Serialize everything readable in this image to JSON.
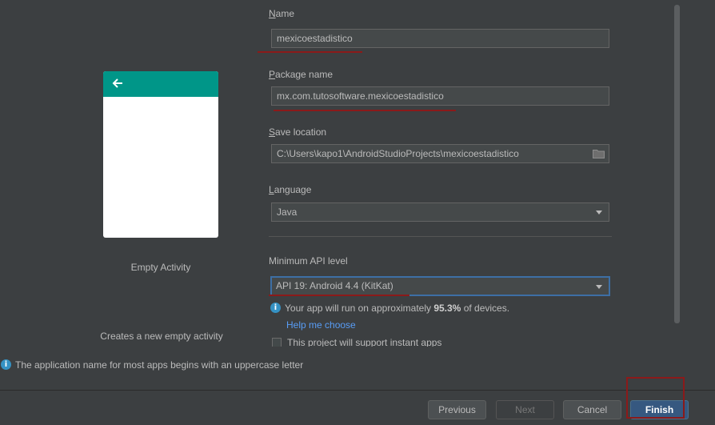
{
  "preview": {
    "template_name": "Empty Activity",
    "template_description": "Creates a new empty activity",
    "appbar_color": "#009688"
  },
  "form": {
    "name": {
      "label_mnemonic": "N",
      "label_rest": "ame",
      "value": "mexicoestadistico"
    },
    "package": {
      "label_mnemonic": "P",
      "label_rest": "ackage name",
      "value": "mx.com.tutosoftware.mexicoestadistico"
    },
    "save_location": {
      "label_mnemonic": "S",
      "label_rest": "ave location",
      "value": "C:\\Users\\kapo1\\AndroidStudioProjects\\mexicoestadistico",
      "icon": "folder-icon"
    },
    "language": {
      "label_mnemonic": "L",
      "label_rest": "anguage",
      "value": "Java"
    },
    "min_api": {
      "label": "Minimum API level",
      "value": "API 19: Android 4.4 (KitKat)"
    },
    "api_info": {
      "prefix": "Your app will run on approximately ",
      "percent": "95.3%",
      "suffix": " of devices."
    },
    "help_link": "Help me choose",
    "instant_apps": {
      "label": "This project will support instant apps",
      "checked": false
    }
  },
  "hint": {
    "icon": "info-icon",
    "text": "The application name for most apps begins with an uppercase letter"
  },
  "buttons": {
    "previous": "Previous",
    "next": "Next",
    "cancel": "Cancel",
    "finish": "Finish"
  },
  "colors": {
    "background": "#3c3f41",
    "field_bg": "#45494a",
    "focus_border": "#3d6fa5",
    "annotation_red": "#8b1a1a",
    "link": "#589df6",
    "primary_button": "#365880"
  }
}
